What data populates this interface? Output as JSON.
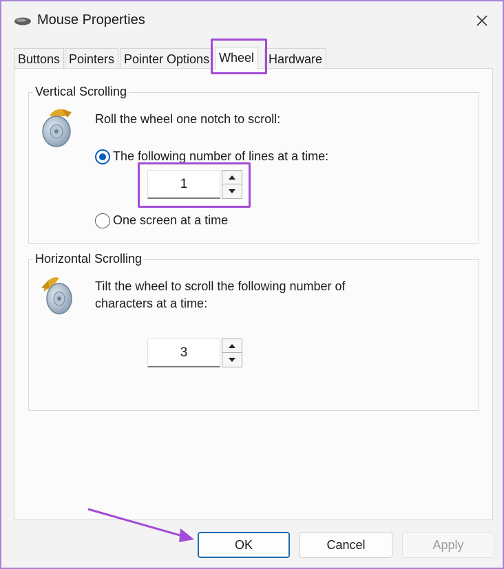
{
  "window": {
    "title": "Mouse Properties",
    "title_icon": "mouse-icon",
    "close_icon": "close-icon"
  },
  "tabs": [
    {
      "label": "Buttons",
      "active": false
    },
    {
      "label": "Pointers",
      "active": false
    },
    {
      "label": "Pointer Options",
      "active": false
    },
    {
      "label": "Wheel",
      "active": true
    },
    {
      "label": "Hardware",
      "active": false
    }
  ],
  "vertical": {
    "group_title": "Vertical Scrolling",
    "icon": "mouse-wheel-vertical-icon",
    "instruction": "Roll the wheel one notch to scroll:",
    "option_lines_label": "The following number of lines at a time:",
    "option_lines_selected": true,
    "lines_value": "1",
    "option_screen_label": "One screen at a time",
    "option_screen_selected": false
  },
  "horizontal": {
    "group_title": "Horizontal Scrolling",
    "icon": "mouse-wheel-horizontal-icon",
    "instruction_line1": "Tilt the wheel to scroll the following number of",
    "instruction_line2": "characters at a time:",
    "chars_value": "3"
  },
  "footer": {
    "ok_label": "OK",
    "cancel_label": "Cancel",
    "apply_label": "Apply",
    "apply_enabled": false
  },
  "colors": {
    "highlight": "#a24bd6",
    "accent": "#005fb8"
  }
}
